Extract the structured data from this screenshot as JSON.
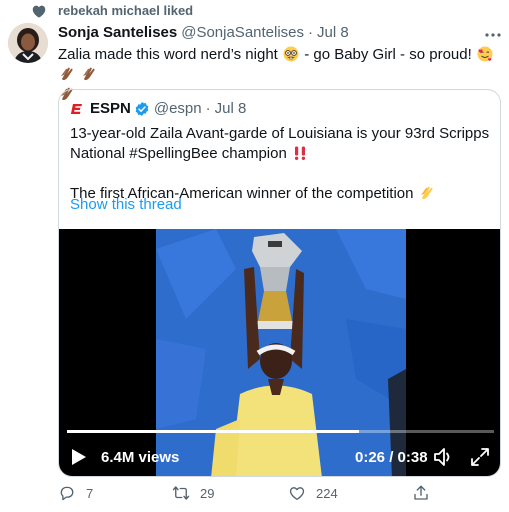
{
  "social_context": {
    "text": "rebekah michael liked",
    "icon": "heart-icon"
  },
  "tweet": {
    "name": "Sonja Santelises",
    "handle": "@SonjaSantelises",
    "separator": "·",
    "date": "Jul 8",
    "text_part1": "Zalia made this word nerd’s night",
    "text_part2": "- go Baby Girl - so proud!",
    "emojis": [
      "nerd-face",
      "smiling-face-with-hearts",
      "clapping-hands",
      "clapping-hands",
      "clapping-hands"
    ]
  },
  "quote": {
    "logo": "E",
    "name": "ESPN",
    "verified": true,
    "handle": "@espn",
    "separator": "·",
    "date": "Jul 8",
    "line1": "13-year-old Zaila Avant-garde of Louisiana is your 93rd Scripps National #SpellingBee champion",
    "line2": "The first African-American winner of the competition",
    "show_thread": "Show this thread"
  },
  "video": {
    "views": "6.4M views",
    "time": "0:26 / 0:38",
    "progress": 0.684
  },
  "actions": {
    "replies": "7",
    "retweets": "29",
    "likes": "224"
  },
  "colors": {
    "accent": "#1d9bf0",
    "secondary_text": "#536471",
    "primary_text": "#0f1419",
    "espn_red": "#e01e24",
    "border": "#cfd9de"
  }
}
